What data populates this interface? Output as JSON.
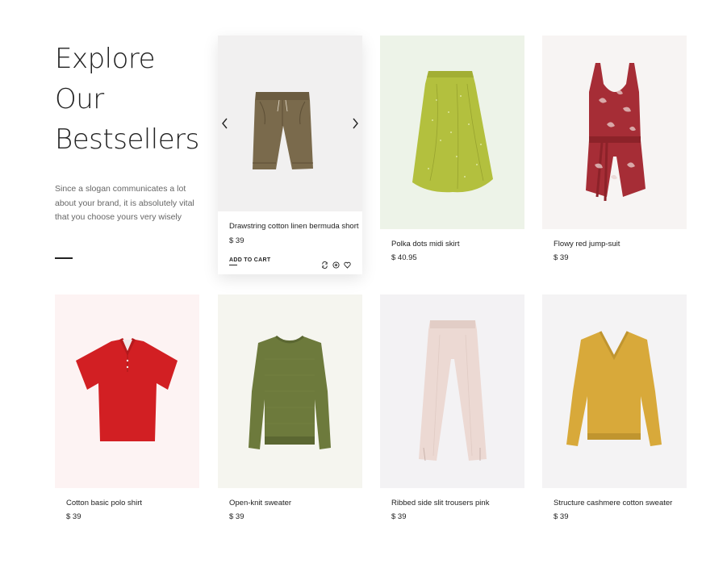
{
  "intro": {
    "title_lines": [
      "Explore",
      "Our",
      "Bestsellers"
    ],
    "description": "Since a slogan communicates a lot about your brand, it is absolutely vital that you choose yours very wisely"
  },
  "featured": {
    "name": "Drawstring cotton linen bermuda short",
    "price": "$ 39",
    "add_to_cart_label": "ADD TO CART",
    "icons": [
      "prev-arrow-icon",
      "next-arrow-icon",
      "compare-icon",
      "quick-view-icon",
      "wishlist-heart-icon"
    ]
  },
  "products": [
    {
      "name": "Polka dots midi skirt",
      "price": "$ 40.95",
      "bg": "#edf3e8"
    },
    {
      "name": "Flowy red jump-suit",
      "price": "$ 39",
      "bg": "#f7f4f3"
    },
    {
      "name": "Cotton basic polo shirt",
      "price": "$ 39",
      "bg": "#fdf3f3"
    },
    {
      "name": "Open-knit sweater",
      "price": "$ 39",
      "bg": "#f5f5ef"
    },
    {
      "name": "Ribbed side slit trousers pink",
      "price": "$ 39",
      "bg": "#f3f2f4"
    },
    {
      "name": "Structure cashmere cotton sweater",
      "price": "$ 39",
      "bg": "#f4f3f4"
    }
  ],
  "colors": {
    "shorts": "#7a6a4c",
    "skirt": "#b3c03e",
    "jumpsuit": "#a62d36",
    "polo": "#d21f23",
    "knit": "#6d7a3c",
    "trousers": "#ecd9d3",
    "cashmere": "#d8a93a"
  }
}
